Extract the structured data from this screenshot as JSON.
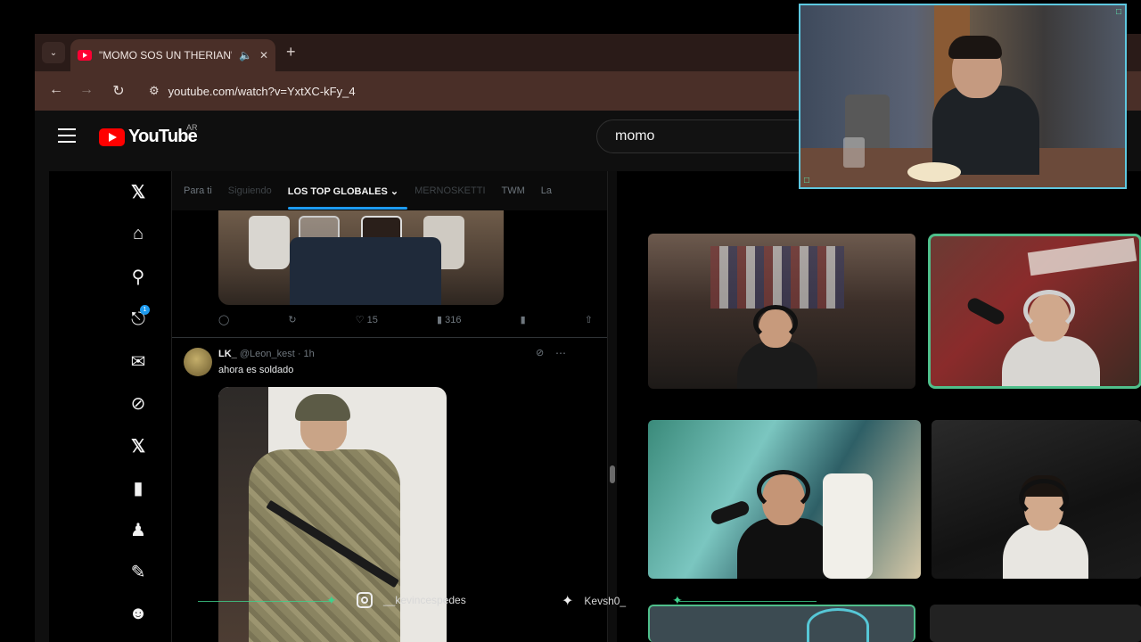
{
  "browser": {
    "tab": {
      "title": "\"MOMO SOS UN THERIAN\"",
      "audio_icon": "speaker-icon",
      "close_icon": "close-icon"
    },
    "new_tab_icon": "plus-icon",
    "nav": {
      "back": "←",
      "forward": "→",
      "reload": "↻",
      "site_info": "⚙"
    },
    "url": "youtube.com/watch?v=YxtXC-kFy_4"
  },
  "youtube": {
    "logo_text": "YouTube",
    "country": "AR",
    "search_value": "momo"
  },
  "x_sidebar": {
    "icons": [
      "x-logo-icon",
      "home-icon",
      "search-icon",
      "notifications-icon",
      "messages-icon",
      "grok-icon",
      "x-premium-icon",
      "bookmarks-icon",
      "communities-icon",
      "lists-icon",
      "profile-icon"
    ],
    "notification_count": "1"
  },
  "feed": {
    "tabs": [
      {
        "label": "Para ti"
      },
      {
        "label": "Siguiendo"
      },
      {
        "label": "LOS TOP GLOBALES ⌄"
      },
      {
        "label": "MERNOSKETTI"
      },
      {
        "label": "TWM"
      },
      {
        "label": "La"
      }
    ],
    "tweet1_actions": {
      "reply": "",
      "retweet": "",
      "like": "15",
      "views": "316"
    },
    "tweet2": {
      "name": "LK_",
      "handle": "@Leon_kest · 1h",
      "text": "ahora es soldado"
    }
  },
  "overlay": {
    "instagram": "__kevincespedes",
    "twitter": "Kevsh0_"
  },
  "colors": {
    "accent_blue": "#1d9bf0",
    "cam_border": "#4fbf8b",
    "youtube_red": "#ff0000",
    "webcam_border": "#5ec8e0"
  }
}
